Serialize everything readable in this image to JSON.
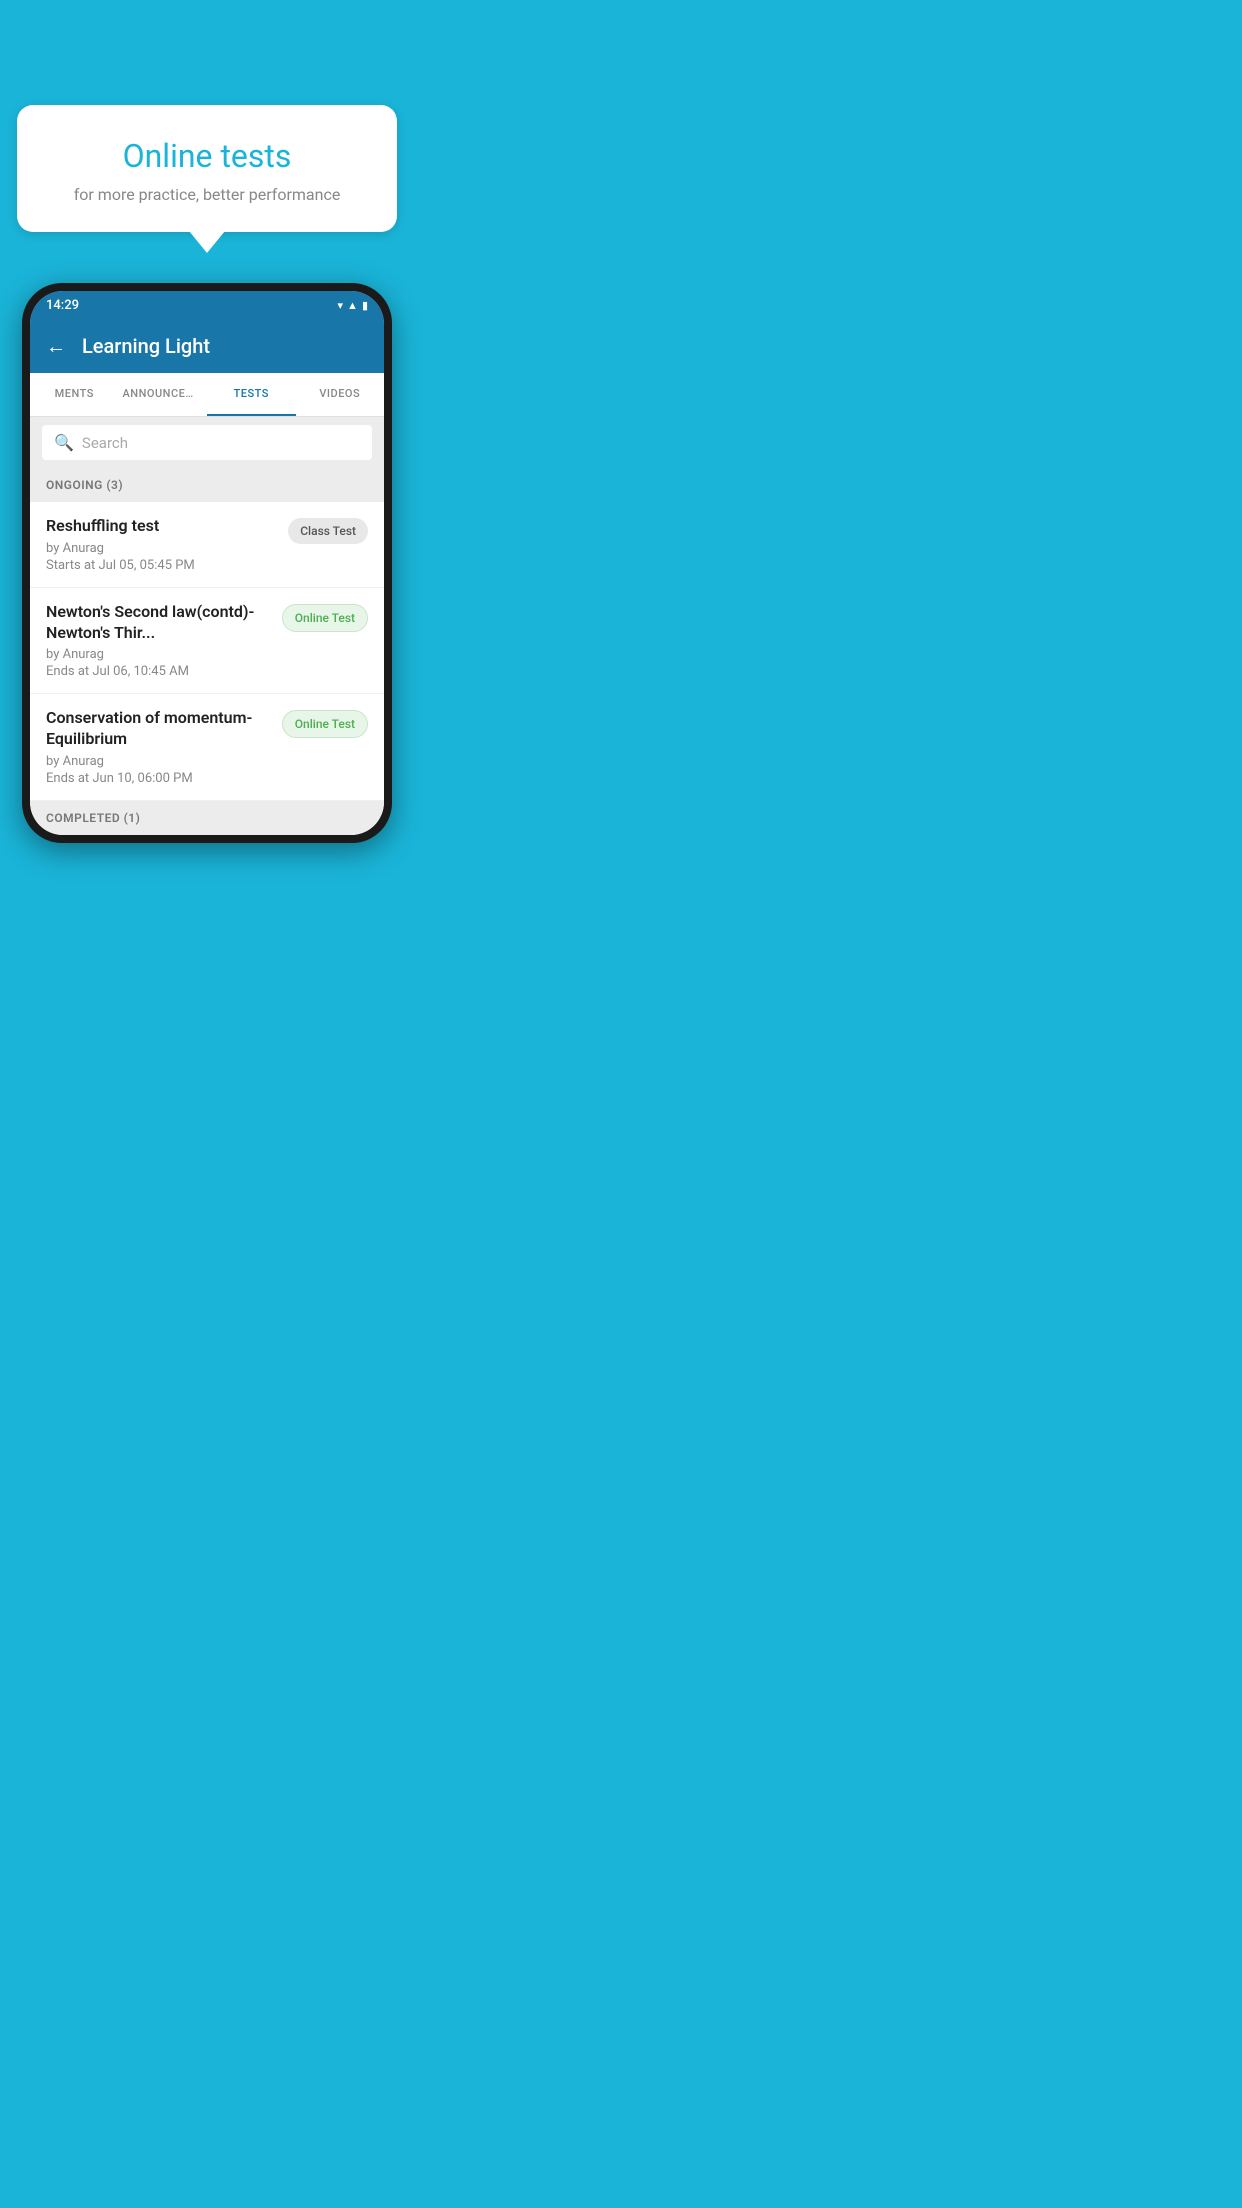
{
  "background_color": "#1ab4d8",
  "speech_bubble": {
    "title": "Online tests",
    "subtitle": "for more practice, better performance"
  },
  "phone": {
    "status_bar": {
      "time": "14:29",
      "icons": [
        "wifi",
        "signal",
        "battery"
      ]
    },
    "app_bar": {
      "title": "Learning Light",
      "back_label": "←"
    },
    "tabs": [
      {
        "label": "MENTS",
        "active": false
      },
      {
        "label": "ANNOUNCEMENTS",
        "active": false
      },
      {
        "label": "TESTS",
        "active": true
      },
      {
        "label": "VIDEOS",
        "active": false
      }
    ],
    "search": {
      "placeholder": "Search"
    },
    "section_ongoing": {
      "label": "ONGOING (3)"
    },
    "tests_ongoing": [
      {
        "title": "Reshuffling test",
        "author": "by Anurag",
        "date": "Starts at  Jul 05, 05:45 PM",
        "badge": "Class Test",
        "badge_type": "class"
      },
      {
        "title": "Newton's Second law(contd)-Newton's Thir...",
        "author": "by Anurag",
        "date": "Ends at  Jul 06, 10:45 AM",
        "badge": "Online Test",
        "badge_type": "online"
      },
      {
        "title": "Conservation of momentum-Equilibrium",
        "author": "by Anurag",
        "date": "Ends at  Jun 10, 06:00 PM",
        "badge": "Online Test",
        "badge_type": "online"
      }
    ],
    "section_completed": {
      "label": "COMPLETED (1)"
    }
  }
}
